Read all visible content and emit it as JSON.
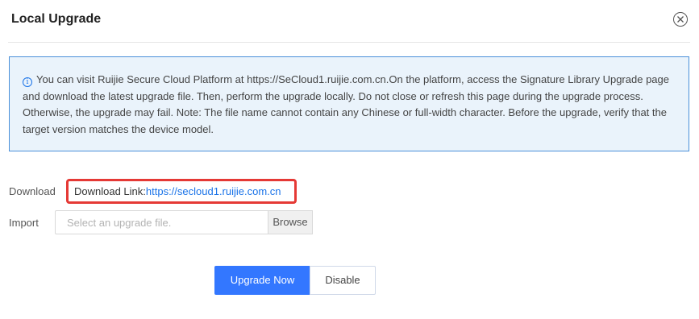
{
  "dialog": {
    "title": "Local Upgrade",
    "close_icon": "close-circle-icon"
  },
  "notice": {
    "icon": "info-icon",
    "icon_glyph": "i",
    "text": "You can visit Ruijie Secure Cloud Platform at https://SeCloud1.ruijie.com.cn.On the platform, access the Signature Library Upgrade page and download the latest upgrade file. Then, perform the upgrade locally. Do not close or refresh this page during the upgrade process. Otherwise, the upgrade may fail. Note: The file name cannot contain any Chinese or full-width character. Before the upgrade, verify that the target version matches the device model.",
    "border_color": "#4a90d9",
    "background_color": "#eaf3fb"
  },
  "download": {
    "label": "Download",
    "prefix": "Download Link:",
    "link_text": "https://secloud1.ruijie.com.cn",
    "highlight_color": "#e53935"
  },
  "import": {
    "label": "Import",
    "placeholder": "Select an upgrade file.",
    "value": "",
    "browse_label": "Browse"
  },
  "actions": {
    "upgrade_label": "Upgrade Now",
    "disable_label": "Disable",
    "primary_color": "#3377ff"
  }
}
